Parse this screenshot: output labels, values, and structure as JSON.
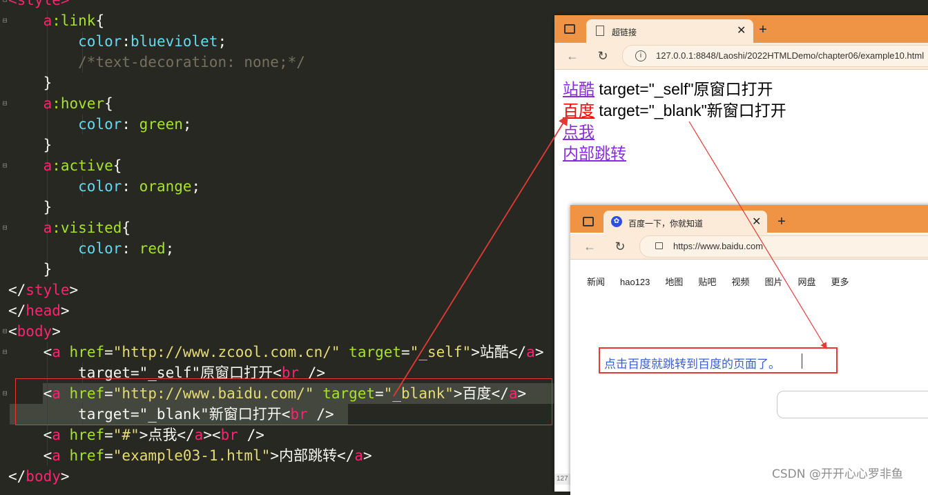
{
  "editor": {
    "lines": [
      {
        "fold": "⊟",
        "guides": 0,
        "tokens": [
          [
            "tag",
            "<style>"
          ]
        ]
      },
      {
        "fold": "⊟",
        "guides": 1,
        "tokens": [
          [
            "txt",
            "    "
          ],
          [
            "sel",
            "a"
          ],
          [
            "pc",
            ":link"
          ],
          [
            "br",
            "{"
          ]
        ]
      },
      {
        "fold": "",
        "guides": 2,
        "tokens": [
          [
            "txt",
            "        "
          ],
          [
            "val",
            "color"
          ],
          [
            "br",
            ":"
          ],
          [
            "val",
            "blueviolet"
          ],
          [
            "br",
            ";"
          ]
        ]
      },
      {
        "fold": "",
        "guides": 2,
        "tokens": [
          [
            "txt",
            "        "
          ],
          [
            "com",
            "/*text-decoration: none;*/"
          ]
        ]
      },
      {
        "fold": "",
        "guides": 1,
        "tokens": [
          [
            "txt",
            "    "
          ],
          [
            "br",
            "}"
          ]
        ]
      },
      {
        "fold": "⊟",
        "guides": 1,
        "tokens": [
          [
            "txt",
            "    "
          ],
          [
            "sel",
            "a"
          ],
          [
            "pc",
            ":hover"
          ],
          [
            "br",
            "{"
          ]
        ]
      },
      {
        "fold": "",
        "guides": 2,
        "tokens": [
          [
            "txt",
            "        "
          ],
          [
            "val",
            "color"
          ],
          [
            "br",
            ": "
          ],
          [
            "attr",
            "green"
          ],
          [
            "br",
            ";"
          ]
        ]
      },
      {
        "fold": "",
        "guides": 1,
        "tokens": [
          [
            "txt",
            "    "
          ],
          [
            "br",
            "}"
          ]
        ]
      },
      {
        "fold": "⊟",
        "guides": 1,
        "tokens": [
          [
            "txt",
            "    "
          ],
          [
            "sel",
            "a"
          ],
          [
            "pc",
            ":active"
          ],
          [
            "br",
            "{"
          ]
        ]
      },
      {
        "fold": "",
        "guides": 2,
        "tokens": [
          [
            "txt",
            "        "
          ],
          [
            "val",
            "color"
          ],
          [
            "br",
            ": "
          ],
          [
            "attr",
            "orange"
          ],
          [
            "br",
            ";"
          ]
        ]
      },
      {
        "fold": "",
        "guides": 1,
        "tokens": [
          [
            "txt",
            "    "
          ],
          [
            "br",
            "}"
          ]
        ]
      },
      {
        "fold": "⊟",
        "guides": 1,
        "tokens": [
          [
            "txt",
            "    "
          ],
          [
            "sel",
            "a"
          ],
          [
            "pc",
            ":visited"
          ],
          [
            "br",
            "{"
          ]
        ]
      },
      {
        "fold": "",
        "guides": 2,
        "tokens": [
          [
            "txt",
            "        "
          ],
          [
            "val",
            "color"
          ],
          [
            "br",
            ": "
          ],
          [
            "attr",
            "red"
          ],
          [
            "br",
            ";"
          ]
        ]
      },
      {
        "fold": "",
        "guides": 1,
        "tokens": [
          [
            "txt",
            "    "
          ],
          [
            "br",
            "}"
          ]
        ]
      },
      {
        "fold": "",
        "guides": 0,
        "tokens": [
          [
            "br",
            "</"
          ],
          [
            "tag",
            "style"
          ],
          [
            "br",
            ">"
          ]
        ]
      },
      {
        "fold": "",
        "guides": 0,
        "tokens": [
          [
            "br",
            "</"
          ],
          [
            "tag",
            "head"
          ],
          [
            "br",
            ">"
          ]
        ]
      },
      {
        "fold": "⊟",
        "guides": 0,
        "tokens": [
          [
            "br",
            "<"
          ],
          [
            "tag",
            "body"
          ],
          [
            "br",
            ">"
          ]
        ]
      },
      {
        "fold": "⊟",
        "guides": 1,
        "tokens": [
          [
            "txt",
            "    "
          ],
          [
            "br",
            "<"
          ],
          [
            "tag",
            "a"
          ],
          [
            "txt",
            " "
          ],
          [
            "attr",
            "href"
          ],
          [
            "br",
            "="
          ],
          [
            "str",
            "\"http://www.zcool.com.cn/\""
          ],
          [
            "txt",
            " "
          ],
          [
            "attr",
            "target"
          ],
          [
            "br",
            "="
          ],
          [
            "str",
            "\"_self\""
          ],
          [
            "br",
            ">"
          ],
          [
            "txt",
            "站酷"
          ],
          [
            "br",
            "</"
          ],
          [
            "tag",
            "a"
          ],
          [
            "br",
            ">"
          ]
        ]
      },
      {
        "fold": "",
        "guides": 2,
        "tokens": [
          [
            "txt",
            "        target=\"_self\"原窗口打开"
          ],
          [
            "br",
            "<"
          ],
          [
            "tag",
            "br"
          ],
          [
            "txt",
            " "
          ],
          [
            "br",
            "/>"
          ]
        ]
      },
      {
        "fold": "⊟",
        "guides": 1,
        "hl": true,
        "tokens": [
          [
            "txt",
            "    "
          ],
          [
            "br",
            "<"
          ],
          [
            "tag",
            "a"
          ],
          [
            "txt",
            " "
          ],
          [
            "attr",
            "href"
          ],
          [
            "br",
            "="
          ],
          [
            "str",
            "\"http://www.baidu.com/\""
          ],
          [
            "txt",
            " "
          ],
          [
            "attr",
            "target"
          ],
          [
            "br",
            "="
          ],
          [
            "str",
            "\"_blank\""
          ],
          [
            "br",
            ">"
          ],
          [
            "txt",
            "百度"
          ],
          [
            "br",
            "</"
          ],
          [
            "tag",
            "a"
          ],
          [
            "br",
            ">"
          ]
        ]
      },
      {
        "fold": "",
        "guides": 2,
        "hl": true,
        "tokens": [
          [
            "txt",
            "        target=\"_blank\"新窗口打开"
          ],
          [
            "br",
            "<"
          ],
          [
            "tag",
            "br"
          ],
          [
            "txt",
            " "
          ],
          [
            "br",
            "/>"
          ]
        ]
      },
      {
        "fold": "",
        "guides": 1,
        "tokens": [
          [
            "txt",
            "    "
          ],
          [
            "br",
            "<"
          ],
          [
            "tag",
            "a"
          ],
          [
            "txt",
            " "
          ],
          [
            "attr",
            "href"
          ],
          [
            "br",
            "="
          ],
          [
            "str",
            "\"#\""
          ],
          [
            "br",
            ">"
          ],
          [
            "txt",
            "点我"
          ],
          [
            "br",
            "</"
          ],
          [
            "tag",
            "a"
          ],
          [
            "br",
            "><"
          ],
          [
            "tag",
            "br"
          ],
          [
            "txt",
            " "
          ],
          [
            "br",
            "/>"
          ]
        ]
      },
      {
        "fold": "",
        "guides": 1,
        "tokens": [
          [
            "txt",
            "    "
          ],
          [
            "br",
            "<"
          ],
          [
            "tag",
            "a"
          ],
          [
            "txt",
            " "
          ],
          [
            "attr",
            "href"
          ],
          [
            "br",
            "="
          ],
          [
            "str",
            "\"example03-1.html\""
          ],
          [
            "br",
            ">"
          ],
          [
            "txt",
            "内部跳转"
          ],
          [
            "br",
            "</"
          ],
          [
            "tag",
            "a"
          ],
          [
            "br",
            ">"
          ]
        ]
      },
      {
        "fold": "",
        "guides": 0,
        "tokens": [
          [
            "br",
            "</"
          ],
          [
            "tag",
            "body"
          ],
          [
            "br",
            ">"
          ]
        ]
      }
    ]
  },
  "browser1": {
    "tab_title": "超链接",
    "address": "127.0.0.1:8848/Laoshi/2022HTMLDemo/chapter06/example10.html",
    "status": "127",
    "links": [
      {
        "link": "站酷",
        "text": " target=\"_self\"原窗口打开",
        "color": "#8a2be2"
      },
      {
        "link": "百度",
        "text": " target=\"_blank\"新窗口打开",
        "color": "#ff0000"
      },
      {
        "link": "点我",
        "text": "",
        "color": "#8a2be2"
      },
      {
        "link": "内部跳转",
        "text": "",
        "color": "#8a2be2"
      }
    ]
  },
  "browser2": {
    "tab_title": "百度一下，你就知道",
    "address": "https://www.baidu.com",
    "nav": [
      "新闻",
      "hao123",
      "地图",
      "贴吧",
      "视频",
      "图片",
      "网盘",
      "更多"
    ]
  },
  "annotation": {
    "note": "点击百度就跳转到百度的页面了。"
  },
  "watermark": "CSDN @开开心心罗非鱼",
  "colors": {
    "accent_red": "#e53935",
    "tab_orange": "#ee9444"
  }
}
